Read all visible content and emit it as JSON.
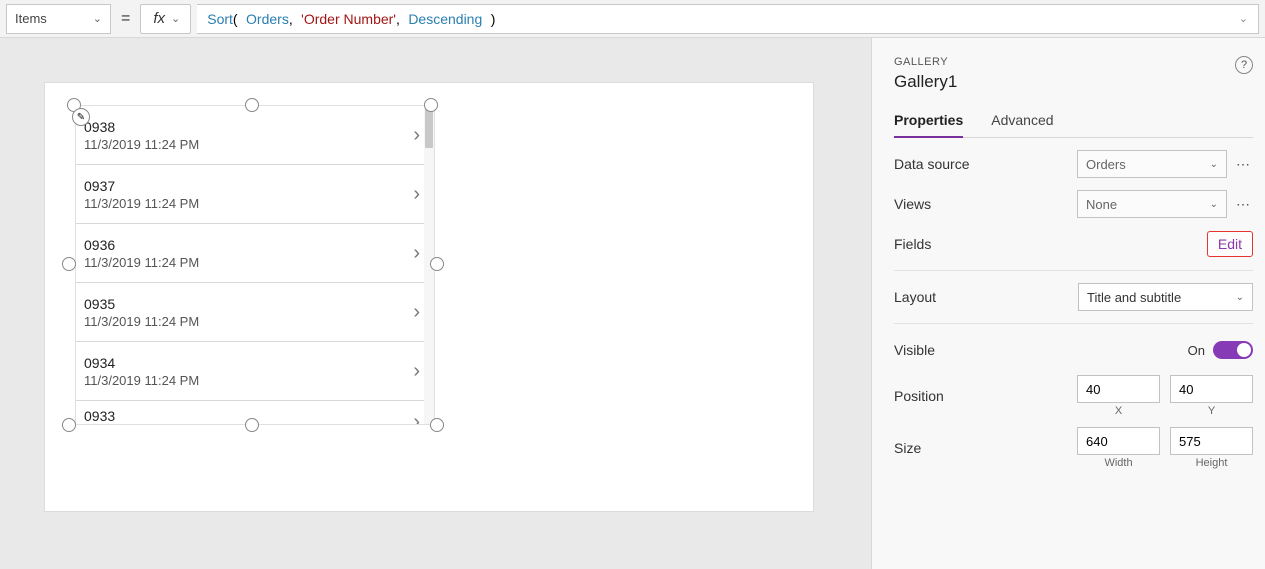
{
  "formulaBar": {
    "property": "Items",
    "fxLabel": "fx",
    "tokens": {
      "fn": "Sort",
      "open": "(",
      "arg1": "Orders",
      "sep1": ",",
      "arg2": "'Order Number'",
      "sep2": ",",
      "arg3": "Descending",
      "close": ")"
    }
  },
  "gallery": {
    "items": [
      {
        "title": "0938",
        "sub": "11/3/2019 11:24 PM"
      },
      {
        "title": "0937",
        "sub": "11/3/2019 11:24 PM"
      },
      {
        "title": "0936",
        "sub": "11/3/2019 11:24 PM"
      },
      {
        "title": "0935",
        "sub": "11/3/2019 11:24 PM"
      },
      {
        "title": "0934",
        "sub": "11/3/2019 11:24 PM"
      },
      {
        "title": "0933",
        "sub": ""
      }
    ]
  },
  "panel": {
    "type": "GALLERY",
    "name": "Gallery1",
    "tabs": {
      "properties": "Properties",
      "advanced": "Advanced"
    },
    "props": {
      "dataSourceLabel": "Data source",
      "dataSourceValue": "Orders",
      "viewsLabel": "Views",
      "viewsValue": "None",
      "fieldsLabel": "Fields",
      "editLabel": "Edit",
      "layoutLabel": "Layout",
      "layoutValue": "Title and subtitle",
      "visibleLabel": "Visible",
      "visibleOn": "On",
      "positionLabel": "Position",
      "posX": "40",
      "posY": "40",
      "posXCap": "X",
      "posYCap": "Y",
      "sizeLabel": "Size",
      "sizeW": "640",
      "sizeH": "575",
      "sizeWCap": "Width",
      "sizeHCap": "Height"
    }
  }
}
